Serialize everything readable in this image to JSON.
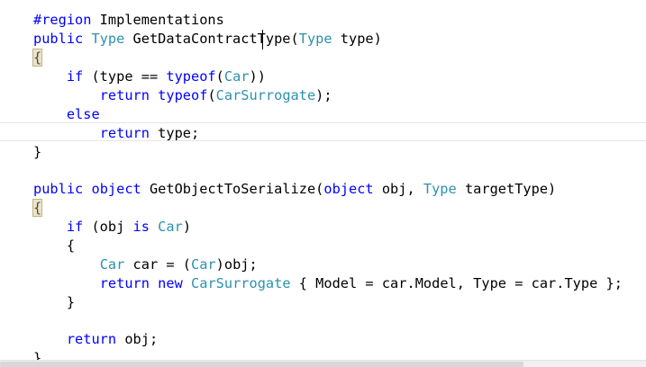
{
  "editor": {
    "lines": [
      {
        "tokens": [
          {
            "t": "#region",
            "c": "kw"
          },
          {
            "t": " Implementations",
            "c": "tx"
          }
        ]
      },
      {
        "tokens": [
          {
            "t": "public",
            "c": "kw"
          },
          {
            "t": " ",
            "c": "tx"
          },
          {
            "t": "Type",
            "c": "ty"
          },
          {
            "t": " GetDataContractType(",
            "c": "tx"
          },
          {
            "t": "Type",
            "c": "ty"
          },
          {
            "t": " type)",
            "c": "tx"
          }
        ]
      },
      {
        "tokens": [
          {
            "t": "{",
            "c": "brace"
          }
        ]
      },
      {
        "tokens": [
          {
            "t": "    ",
            "c": "tx"
          },
          {
            "t": "if",
            "c": "kw"
          },
          {
            "t": " (type == ",
            "c": "tx"
          },
          {
            "t": "typeof",
            "c": "kw"
          },
          {
            "t": "(",
            "c": "tx"
          },
          {
            "t": "Car",
            "c": "ty"
          },
          {
            "t": "))",
            "c": "tx"
          }
        ]
      },
      {
        "tokens": [
          {
            "t": "        ",
            "c": "tx"
          },
          {
            "t": "return",
            "c": "kw"
          },
          {
            "t": " ",
            "c": "tx"
          },
          {
            "t": "typeof",
            "c": "kw"
          },
          {
            "t": "(",
            "c": "tx"
          },
          {
            "t": "CarSurrogate",
            "c": "ty"
          },
          {
            "t": ");",
            "c": "tx"
          }
        ]
      },
      {
        "tokens": [
          {
            "t": "    ",
            "c": "tx"
          },
          {
            "t": "else",
            "c": "kw"
          }
        ]
      },
      {
        "tokens": [
          {
            "t": "        ",
            "c": "tx"
          },
          {
            "t": "return",
            "c": "kw"
          },
          {
            "t": " type;",
            "c": "tx"
          }
        ]
      },
      {
        "tokens": [
          {
            "t": "}",
            "c": "tx"
          }
        ]
      },
      {
        "tokens": []
      },
      {
        "tokens": [
          {
            "t": "public",
            "c": "kw"
          },
          {
            "t": " ",
            "c": "tx"
          },
          {
            "t": "object",
            "c": "kw"
          },
          {
            "t": " GetObjectToSerialize(",
            "c": "tx"
          },
          {
            "t": "object",
            "c": "kw"
          },
          {
            "t": " obj, ",
            "c": "tx"
          },
          {
            "t": "Type",
            "c": "ty"
          },
          {
            "t": " targetType)",
            "c": "tx"
          }
        ]
      },
      {
        "tokens": [
          {
            "t": "{",
            "c": "brace"
          }
        ]
      },
      {
        "tokens": [
          {
            "t": "    ",
            "c": "tx"
          },
          {
            "t": "if",
            "c": "kw"
          },
          {
            "t": " (obj ",
            "c": "tx"
          },
          {
            "t": "is",
            "c": "kw"
          },
          {
            "t": " ",
            "c": "tx"
          },
          {
            "t": "Car",
            "c": "ty"
          },
          {
            "t": ")",
            "c": "tx"
          }
        ]
      },
      {
        "tokens": [
          {
            "t": "    {",
            "c": "tx"
          }
        ]
      },
      {
        "tokens": [
          {
            "t": "        ",
            "c": "tx"
          },
          {
            "t": "Car",
            "c": "ty"
          },
          {
            "t": " car = (",
            "c": "tx"
          },
          {
            "t": "Car",
            "c": "ty"
          },
          {
            "t": ")obj;",
            "c": "tx"
          }
        ]
      },
      {
        "tokens": [
          {
            "t": "        ",
            "c": "tx"
          },
          {
            "t": "return",
            "c": "kw"
          },
          {
            "t": " ",
            "c": "tx"
          },
          {
            "t": "new",
            "c": "kw"
          },
          {
            "t": " ",
            "c": "tx"
          },
          {
            "t": "CarSurrogate",
            "c": "ty"
          },
          {
            "t": " { Model = car.Model, Type = car.Type };",
            "c": "tx"
          }
        ]
      },
      {
        "tokens": [
          {
            "t": "    }",
            "c": "tx"
          }
        ]
      },
      {
        "tokens": []
      },
      {
        "tokens": [
          {
            "t": "    ",
            "c": "tx"
          },
          {
            "t": "return",
            "c": "kw"
          },
          {
            "t": " obj;",
            "c": "tx"
          }
        ]
      },
      {
        "tokens": [
          {
            "t": "}",
            "c": "tx"
          }
        ]
      }
    ]
  },
  "colors": {
    "keyword": "#0000ff",
    "type": "#2b91af",
    "text": "#000000",
    "brace_highlight_bg": "#e2e6d6"
  },
  "scroll": {
    "horizontal_fraction_visible": 0.81
  }
}
